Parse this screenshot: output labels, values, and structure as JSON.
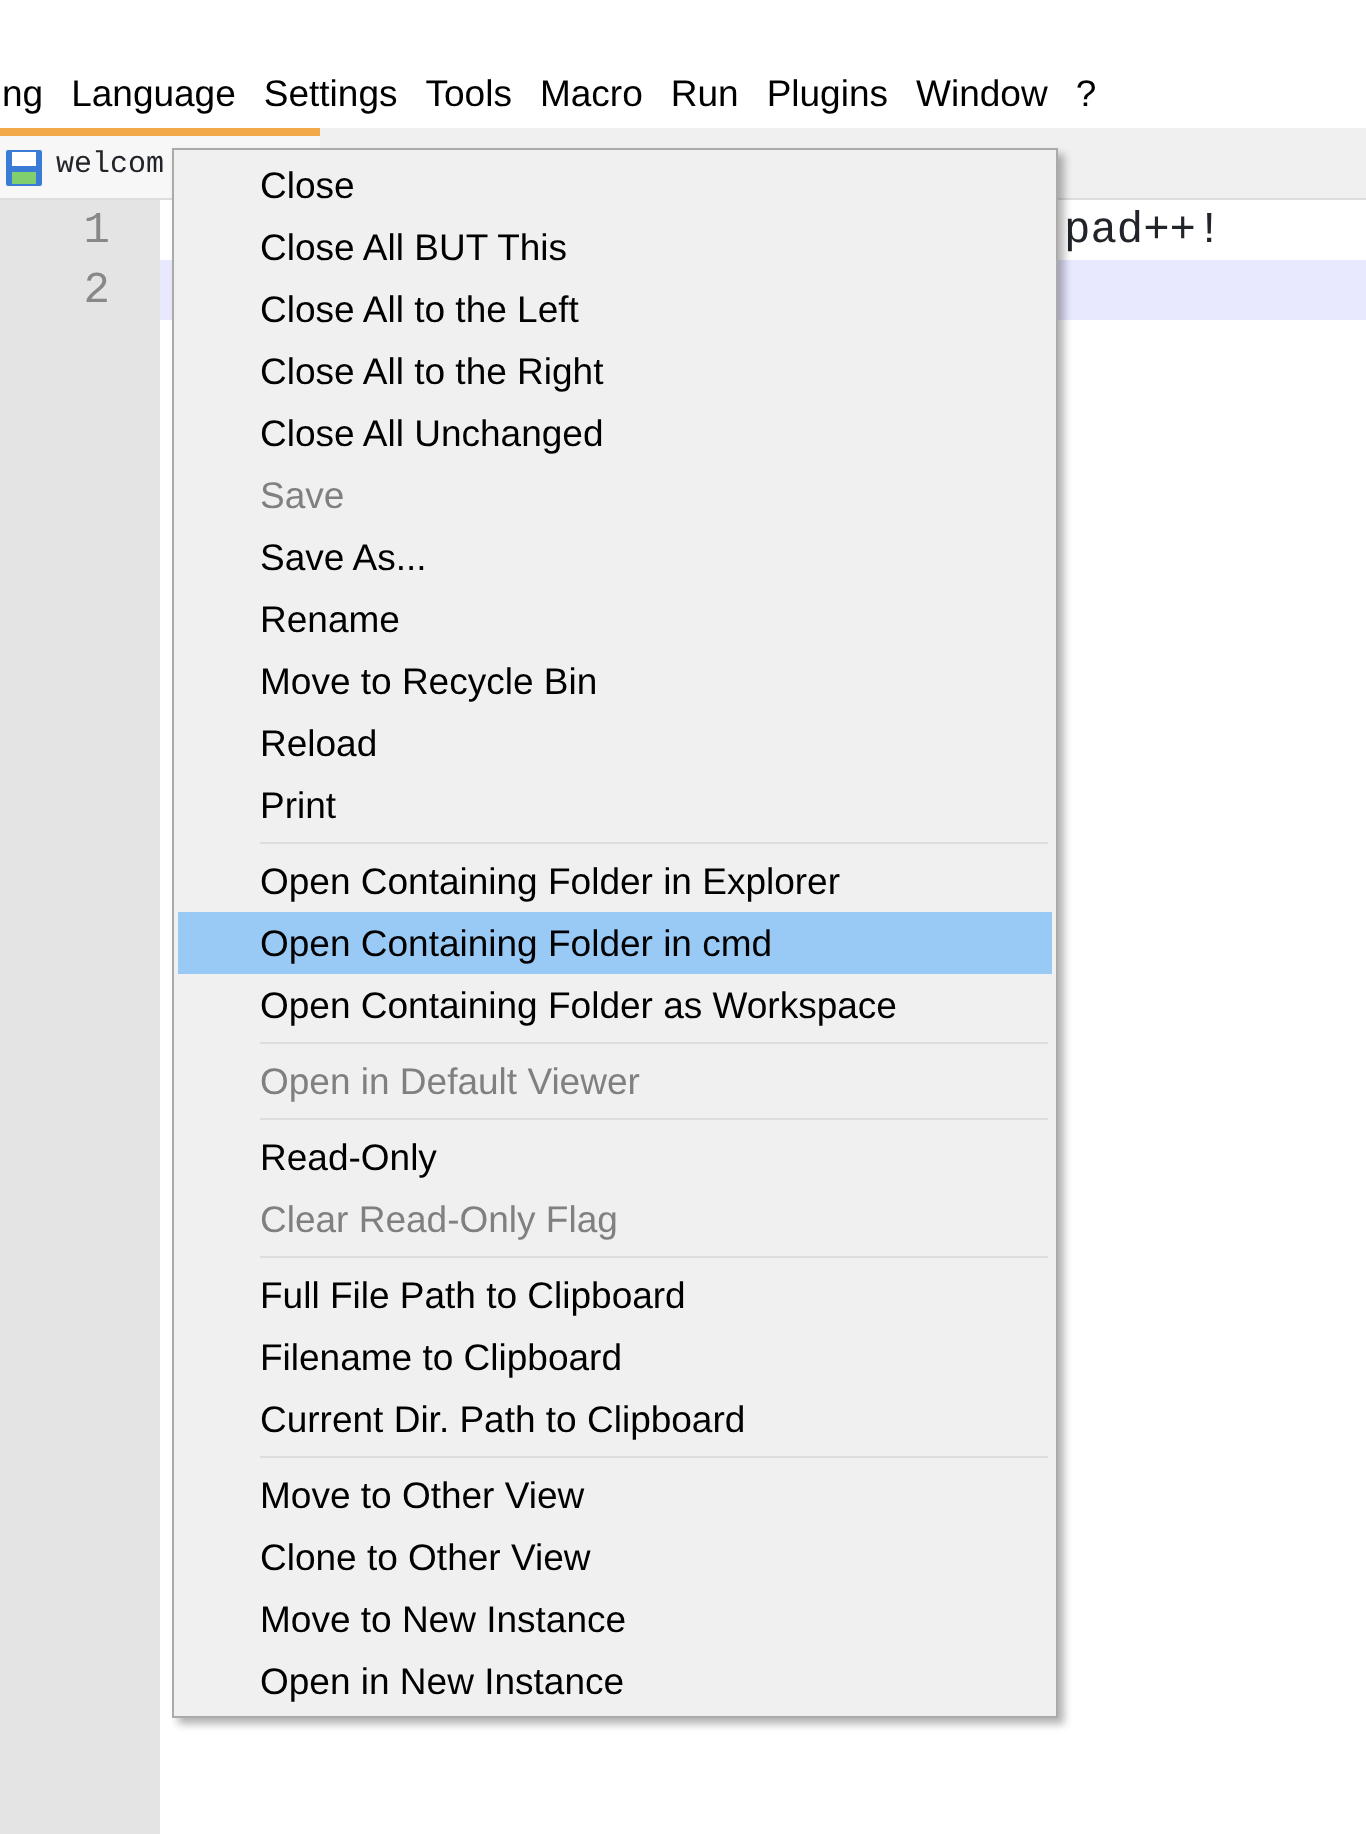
{
  "menu_bar": [
    {
      "label": "ng"
    },
    {
      "label": "Language"
    },
    {
      "label": "Settings"
    },
    {
      "label": "Tools"
    },
    {
      "label": "Macro"
    },
    {
      "label": "Run"
    },
    {
      "label": "Plugins"
    },
    {
      "label": "Window"
    },
    {
      "label": "?"
    }
  ],
  "tabs": [
    {
      "label": "welcom",
      "selected": true
    }
  ],
  "editor": {
    "lines": [
      {
        "number": "1",
        "text_end": "pad++!",
        "current": false
      },
      {
        "number": "2",
        "current": true
      }
    ]
  },
  "context_menu": [
    {
      "kind": "item",
      "label": "Close",
      "disabled": false,
      "selected": false
    },
    {
      "kind": "item",
      "label": "Close All BUT This",
      "disabled": false,
      "selected": false
    },
    {
      "kind": "item",
      "label": "Close All to the Left",
      "disabled": false,
      "selected": false
    },
    {
      "kind": "item",
      "label": "Close All to the Right",
      "disabled": false,
      "selected": false
    },
    {
      "kind": "item",
      "label": "Close All Unchanged",
      "disabled": false,
      "selected": false
    },
    {
      "kind": "item",
      "label": "Save",
      "disabled": true,
      "selected": false
    },
    {
      "kind": "item",
      "label": "Save As...",
      "disabled": false,
      "selected": false
    },
    {
      "kind": "item",
      "label": "Rename",
      "disabled": false,
      "selected": false
    },
    {
      "kind": "item",
      "label": "Move to Recycle Bin",
      "disabled": false,
      "selected": false
    },
    {
      "kind": "item",
      "label": "Reload",
      "disabled": false,
      "selected": false
    },
    {
      "kind": "item",
      "label": "Print",
      "disabled": false,
      "selected": false
    },
    {
      "kind": "separator"
    },
    {
      "kind": "item",
      "label": "Open Containing Folder in Explorer",
      "disabled": false,
      "selected": false
    },
    {
      "kind": "item",
      "label": "Open Containing Folder in cmd",
      "disabled": false,
      "selected": true
    },
    {
      "kind": "item",
      "label": "Open Containing Folder as Workspace",
      "disabled": false,
      "selected": false
    },
    {
      "kind": "separator"
    },
    {
      "kind": "item",
      "label": "Open in Default Viewer",
      "disabled": true,
      "selected": false
    },
    {
      "kind": "separator"
    },
    {
      "kind": "item",
      "label": "Read-Only",
      "disabled": false,
      "selected": false
    },
    {
      "kind": "item",
      "label": "Clear Read-Only Flag",
      "disabled": true,
      "selected": false
    },
    {
      "kind": "separator"
    },
    {
      "kind": "item",
      "label": "Full File Path to Clipboard",
      "disabled": false,
      "selected": false
    },
    {
      "kind": "item",
      "label": "Filename to Clipboard",
      "disabled": false,
      "selected": false
    },
    {
      "kind": "item",
      "label": "Current Dir. Path to Clipboard",
      "disabled": false,
      "selected": false
    },
    {
      "kind": "separator"
    },
    {
      "kind": "item",
      "label": "Move to Other View",
      "disabled": false,
      "selected": false
    },
    {
      "kind": "item",
      "label": "Clone to Other View",
      "disabled": false,
      "selected": false
    },
    {
      "kind": "item",
      "label": "Move to New Instance",
      "disabled": false,
      "selected": false
    },
    {
      "kind": "item",
      "label": "Open in New Instance",
      "disabled": false,
      "selected": false
    }
  ]
}
